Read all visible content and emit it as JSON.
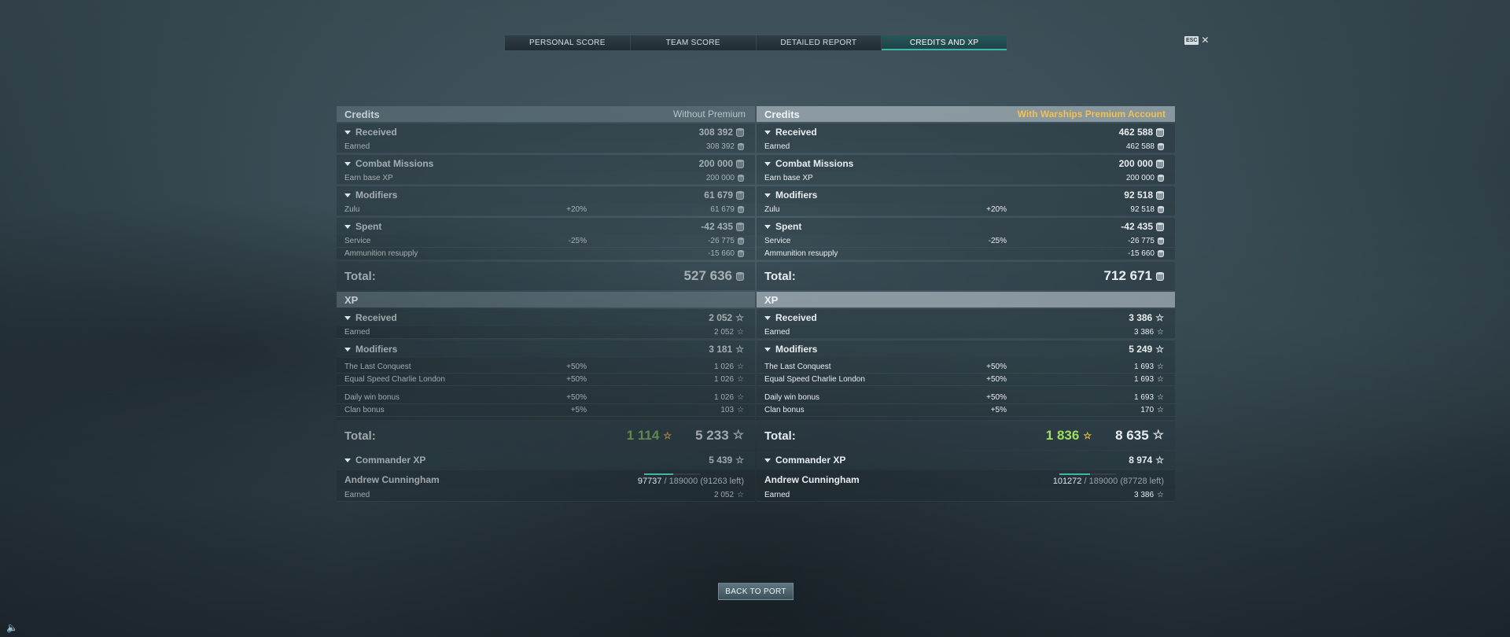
{
  "tabs": [
    "PERSONAL SCORE",
    "TEAM SCORE",
    "DETAILED REPORT",
    "CREDITS AND XP"
  ],
  "active_tab_index": 3,
  "esc": {
    "badge": "ESC",
    "close": "✕"
  },
  "left": {
    "credits_title": "Credits",
    "credits_note": "Without Premium",
    "received": {
      "label": "Received",
      "value": "308 392"
    },
    "earned": {
      "label": "Earned",
      "value": "308 392"
    },
    "missions": {
      "label": "Combat Missions",
      "value": "200 000"
    },
    "earn_base_xp": {
      "label": "Earn base XP",
      "value": "200 000"
    },
    "modifiers": {
      "label": "Modifiers",
      "value": "61 679"
    },
    "zulu": {
      "label": "Zulu",
      "pct": "+20%",
      "value": "61 679"
    },
    "spent": {
      "label": "Spent",
      "value": "-42 435"
    },
    "service": {
      "label": "Service",
      "pct": "-25%",
      "value": "-26 775"
    },
    "ammo": {
      "label": "Ammunition resupply",
      "value": "-15 660"
    },
    "credits_total": {
      "label": "Total:",
      "value": "527 636"
    },
    "xp_title": "XP",
    "xp_received": {
      "label": "Received",
      "value": "2 052"
    },
    "xp_earned": {
      "label": "Earned",
      "value": "2 052"
    },
    "xp_modifiers": {
      "label": "Modifiers",
      "value": "3 181"
    },
    "last_conquest": {
      "label": "The Last Conquest",
      "pct": "+50%",
      "value": "1 026"
    },
    "equal_speed": {
      "label": "Equal Speed Charlie London",
      "pct": "+50%",
      "value": "1 026"
    },
    "daily_win": {
      "label": "Daily win bonus",
      "pct": "+50%",
      "value": "1 026"
    },
    "clan_bonus": {
      "label": "Clan bonus",
      "pct": "+5%",
      "value": "103"
    },
    "xp_total": {
      "label": "Total:",
      "free": "1 114",
      "value": "5 233"
    },
    "commander_xp": {
      "label": "Commander XP",
      "value": "5 439"
    },
    "commander": {
      "name": "Andrew Cunningham",
      "current": "97737",
      "rest": " / 189000 (91263 left)",
      "progress": 0.52
    },
    "cmd_earned": {
      "label": "Earned",
      "value": "2 052"
    }
  },
  "right": {
    "credits_title": "Credits",
    "credits_note": "With Warships Premium Account",
    "received": {
      "label": "Received",
      "value": "462 588"
    },
    "earned": {
      "label": "Earned",
      "value": "462 588"
    },
    "missions": {
      "label": "Combat Missions",
      "value": "200 000"
    },
    "earn_base_xp": {
      "label": "Earn base XP",
      "value": "200 000"
    },
    "modifiers": {
      "label": "Modifiers",
      "value": "92 518"
    },
    "zulu": {
      "label": "Zulu",
      "pct": "+20%",
      "value": "92 518"
    },
    "spent": {
      "label": "Spent",
      "value": "-42 435"
    },
    "service": {
      "label": "Service",
      "pct": "-25%",
      "value": "-26 775"
    },
    "ammo": {
      "label": "Ammunition resupply",
      "value": "-15 660"
    },
    "credits_total": {
      "label": "Total:",
      "value": "712 671"
    },
    "xp_title": "XP",
    "xp_received": {
      "label": "Received",
      "value": "3 386"
    },
    "xp_earned": {
      "label": "Earned",
      "value": "3 386"
    },
    "xp_modifiers": {
      "label": "Modifiers",
      "value": "5 249"
    },
    "last_conquest": {
      "label": "The Last Conquest",
      "pct": "+50%",
      "value": "1 693"
    },
    "equal_speed": {
      "label": "Equal Speed Charlie London",
      "pct": "+50%",
      "value": "1 693"
    },
    "daily_win": {
      "label": "Daily win bonus",
      "pct": "+50%",
      "value": "1 693"
    },
    "clan_bonus": {
      "label": "Clan bonus",
      "pct": "+5%",
      "value": "170"
    },
    "xp_total": {
      "label": "Total:",
      "free": "1 836",
      "value": "8 635"
    },
    "commander_xp": {
      "label": "Commander XP",
      "value": "8 974"
    },
    "commander": {
      "name": "Andrew Cunningham",
      "current": "101272",
      "rest": " / 189000 (87728 left)",
      "progress": 0.54
    },
    "cmd_earned": {
      "label": "Earned",
      "value": "3 386"
    }
  },
  "back_button": "BACK TO PORT",
  "colors": {
    "accent": "#3fb7a8",
    "premium": "#f2c14e",
    "free_xp": "#9ee05a"
  },
  "icons": {
    "credits": "credit-icon",
    "xp": "star-icon",
    "sound": "speaker-icon"
  }
}
